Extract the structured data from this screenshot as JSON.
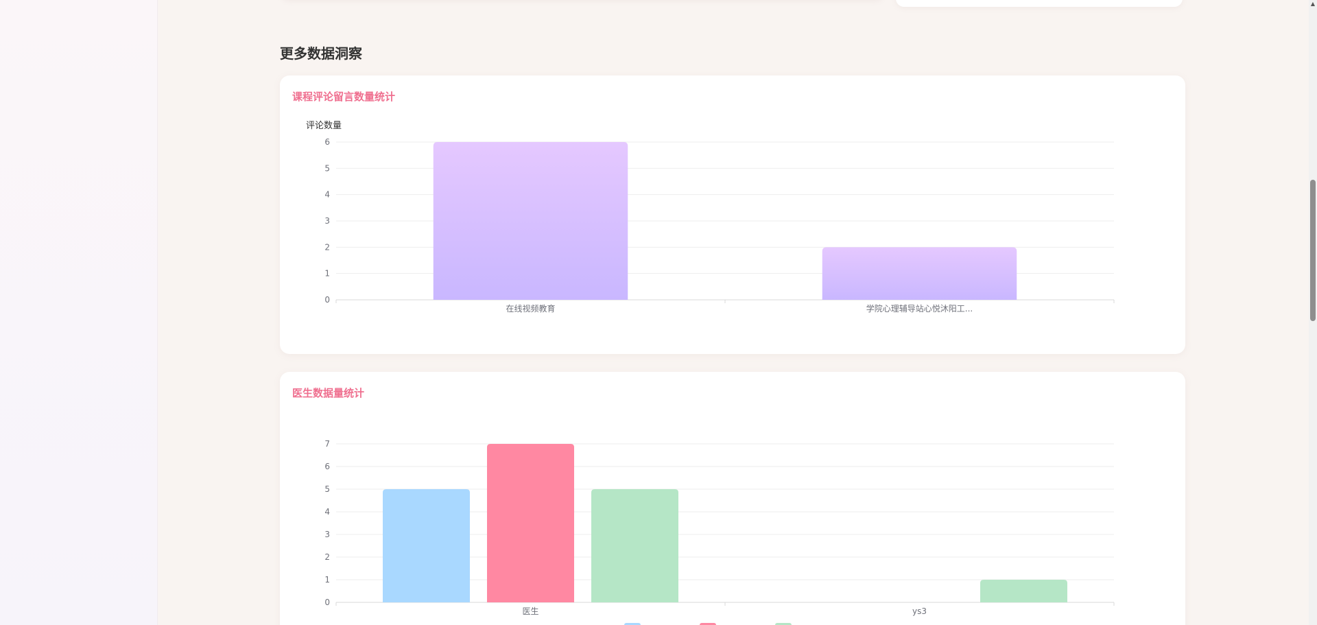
{
  "section": {
    "title": "更多数据洞察"
  },
  "comments_card": {
    "title": "课程评论留言数量统计"
  },
  "doctor_card": {
    "title": "医生数据量统计"
  },
  "chart_data": [
    {
      "type": "bar",
      "title": "课程评论留言数量统计",
      "ylabel": "评论数量",
      "xlabel": "",
      "ylim": [
        0,
        6
      ],
      "yticks": [
        0,
        1,
        2,
        3,
        4,
        5,
        6
      ],
      "categories": [
        "在线视频教育",
        "学院心理辅导站心悦沐阳工..."
      ],
      "values": [
        6,
        2
      ],
      "colors": {
        "top": "#e5c8ff",
        "bottom": "#c9b7ff"
      },
      "grid": true
    },
    {
      "type": "bar",
      "title": "医生数据量统计",
      "ylabel": "",
      "xlabel": "",
      "ylim": [
        0,
        7
      ],
      "yticks": [
        0,
        1,
        2,
        3,
        4,
        5,
        6,
        7
      ],
      "categories": [
        "医生",
        "ys3"
      ],
      "series": [
        {
          "values": [
            5,
            0
          ],
          "color": "#a9d8ff"
        },
        {
          "values": [
            7,
            0
          ],
          "color": "#ff88a2"
        },
        {
          "values": [
            5,
            1
          ],
          "color": "#b5e6c6"
        }
      ],
      "legend": "bottom",
      "grid": true
    }
  ]
}
